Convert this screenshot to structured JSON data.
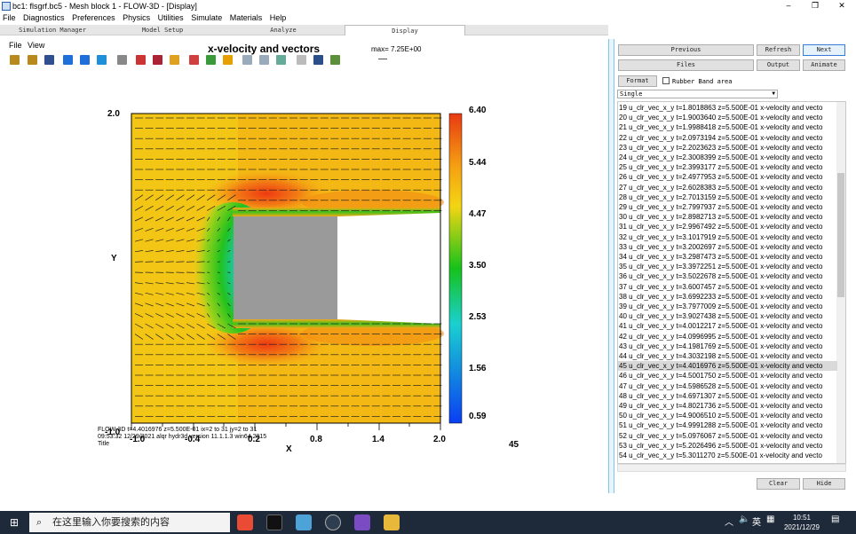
{
  "window": {
    "title": "bc1: flsgrf.bc5 - Mesh block 1 - FLOW-3D - [Display]",
    "minimize": "–",
    "maximize": "❐",
    "close": "✕"
  },
  "menu": [
    "File",
    "Diagnostics",
    "Preferences",
    "Physics",
    "Utilities",
    "Simulate",
    "Materials",
    "Help"
  ],
  "tabs": [
    "Simulation Manager",
    "Model Setup",
    "Analyze",
    "Display"
  ],
  "active_tab": "Display",
  "display_menu": [
    "File",
    "View"
  ],
  "plot": {
    "title": "x-velocity and vectors",
    "max": "max= 7.25E+00",
    "xlabel": "X",
    "ylabel": "Y",
    "yticks": [
      "2.0",
      "-1.0"
    ],
    "xticks": [
      "-1.0",
      "-0.4",
      "0.2",
      "0.8",
      "1.4",
      "2.0"
    ],
    "colorbar": [
      "6.40",
      "5.44",
      "4.47",
      "3.50",
      "2.53",
      "1.56",
      "0.59"
    ],
    "footer_line1": "FLOW-3D  t=4.4016976  z=5.500E-01  ix=2 to 31  jy=2 to 31",
    "footer_line2": "09:53:32  12/29/2021 alqr     hydr3d   version  11.1.1.3  win64 2015",
    "footer_line3": "Title",
    "page": "45"
  },
  "buttons": {
    "previous": "Previous",
    "refresh": "Refresh",
    "next": "Next",
    "files": "Files",
    "output": "Output",
    "animate": "Animate",
    "format": "Format",
    "rubber_band": "Rubber Band area",
    "clear": "Clear",
    "hide": "Hide"
  },
  "select_value": "Single",
  "list_rows": [
    "19 u_clr_vec_x_y  t=1.8018863  z=5.500E-01  x-velocity and vecto",
    "20 u_clr_vec_x_y  t=1.9003640  z=5.500E-01  x-velocity and vecto",
    "21 u_clr_vec_x_y  t=1.9988418  z=5.500E-01  x-velocity and vecto",
    "22 u_clr_vec_x_y  t=2.0973194  z=5.500E-01  x-velocity and vecto",
    "23 u_clr_vec_x_y  t=2.2023623  z=5.500E-01  x-velocity and vecto",
    "24 u_clr_vec_x_y  t=2.3008399  z=5.500E-01  x-velocity and vecto",
    "25 u_clr_vec_x_y  t=2.3993177  z=5.500E-01  x-velocity and vecto",
    "26 u_clr_vec_x_y  t=2.4977953  z=5.500E-01  x-velocity and vecto",
    "27 u_clr_vec_x_y  t=2.6028383  z=5.500E-01  x-velocity and vecto",
    "28 u_clr_vec_x_y  t=2.7013159  z=5.500E-01  x-velocity and vecto",
    "29 u_clr_vec_x_y  t=2.7997937  z=5.500E-01  x-velocity and vecto",
    "30 u_clr_vec_x_y  t=2.8982713  z=5.500E-01  x-velocity and vecto",
    "31 u_clr_vec_x_y  t=2.9967492  z=5.500E-01  x-velocity and vecto",
    "32 u_clr_vec_x_y  t=3.1017919  z=5.500E-01  x-velocity and vecto",
    "33 u_clr_vec_x_y  t=3.2002697  z=5.500E-01  x-velocity and vecto",
    "34 u_clr_vec_x_y  t=3.2987473  z=5.500E-01  x-velocity and vecto",
    "35 u_clr_vec_x_y  t=3.3972251  z=5.500E-01  x-velocity and vecto",
    "36 u_clr_vec_x_y  t=3.5022678  z=5.500E-01  x-velocity and vecto",
    "37 u_clr_vec_x_y  t=3.6007457  z=5.500E-01  x-velocity and vecto",
    "38 u_clr_vec_x_y  t=3.6992233  z=5.500E-01  x-velocity and vecto",
    "39 u_clr_vec_x_y  t=3.7977009  z=5.500E-01  x-velocity and vecto",
    "40 u_clr_vec_x_y  t=3.9027438  z=5.500E-01  x-velocity and vecto",
    "41 u_clr_vec_x_y  t=4.0012217  z=5.500E-01  x-velocity and vecto",
    "42 u_clr_vec_x_y  t=4.0996995  z=5.500E-01  x-velocity and vecto",
    "43 u_clr_vec_x_y  t=4.1981769  z=5.500E-01  x-velocity and vecto",
    "44 u_clr_vec_x_y  t=4.3032198  z=5.500E-01  x-velocity and vecto",
    "45 u_clr_vec_x_y  t=4.4016976  z=5.500E-01  x-velocity and vecto",
    "46 u_clr_vec_x_y  t=4.5001750  z=5.500E-01  x-velocity and vecto",
    "47 u_clr_vec_x_y  t=4.5986528  z=5.500E-01  x-velocity and vecto",
    "48 u_clr_vec_x_y  t=4.6971307  z=5.500E-01  x-velocity and vecto",
    "49 u_clr_vec_x_y  t=4.8021736  z=5.500E-01  x-velocity and vecto",
    "50 u_clr_vec_x_y  t=4.9006510  z=5.500E-01  x-velocity and vecto",
    "51 u_clr_vec_x_y  t=4.9991288  z=5.500E-01  x-velocity and vecto",
    "52 u_clr_vec_x_y  t=5.0976067  z=5.500E-01  x-velocity and vecto",
    "53 u_clr_vec_x_y  t=5.2026496  z=5.500E-01  x-velocity and vecto",
    "54 u_clr_vec_x_y  t=5.3011270  z=5.500E-01  x-velocity and vecto"
  ],
  "selected_row": 26,
  "taskbar": {
    "search_placeholder": "在这里输入你要搜索的内容",
    "ime": "英",
    "time": "10:51",
    "date": "2021/12/29"
  }
}
